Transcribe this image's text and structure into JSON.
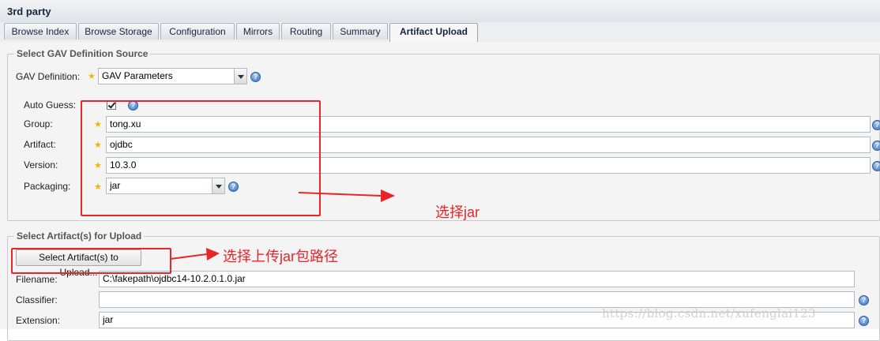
{
  "window": {
    "title": "3rd party"
  },
  "tabs": [
    {
      "label": "Browse Index"
    },
    {
      "label": "Browse Storage"
    },
    {
      "label": "Configuration"
    },
    {
      "label": "Mirrors"
    },
    {
      "label": "Routing"
    },
    {
      "label": "Summary"
    },
    {
      "label": "Artifact Upload",
      "active": true
    }
  ],
  "gav_section": {
    "legend": "Select GAV Definition Source",
    "gav_definition": {
      "label": "GAV Definition:",
      "value": "GAV Parameters"
    },
    "auto_guess": {
      "label": "Auto Guess:",
      "checked": true
    },
    "group": {
      "label": "Group:",
      "value": "tong.xu"
    },
    "artifact": {
      "label": "Artifact:",
      "value": "ojdbc"
    },
    "version": {
      "label": "Version:",
      "value": "10.3.0"
    },
    "packaging": {
      "label": "Packaging:",
      "value": "jar"
    }
  },
  "upload_section": {
    "legend": "Select Artifact(s) for Upload",
    "select_button": "Select Artifact(s) to Upload...",
    "filename": {
      "label": "Filename:",
      "value": "C:\\fakepath\\ojdbc14-10.2.0.1.0.jar"
    },
    "classifier": {
      "label": "Classifier:",
      "value": ""
    },
    "extension": {
      "label": "Extension:",
      "value": "jar"
    }
  },
  "annotations": {
    "select_jar": "选择jar",
    "select_upload_path": "选择上传jar包路径"
  },
  "watermark": "https://blog.csdn.net/xufenglai123",
  "colors": {
    "annotation_red": "#e8262a",
    "required_star": "#f4b400",
    "help_icon": "#3c74c2"
  }
}
